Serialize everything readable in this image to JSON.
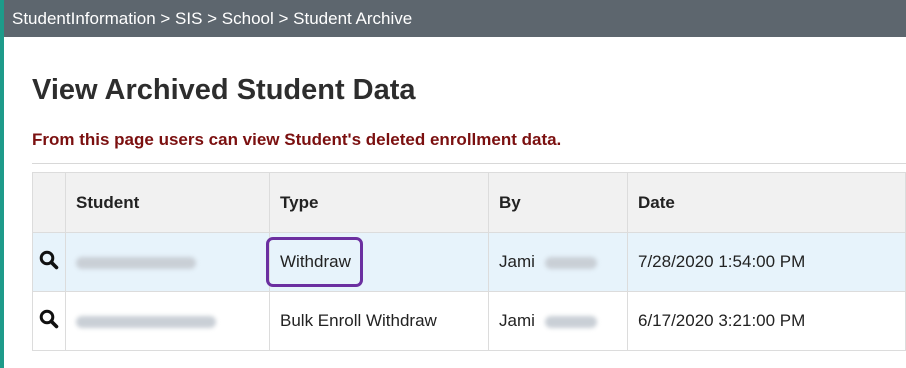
{
  "breadcrumb": "StudentInformation > SIS > School > Student Archive",
  "page": {
    "title": "View Archived Student Data",
    "subtitle": "From this page users can view Student's deleted enrollment data."
  },
  "table": {
    "headers": {
      "icon": "",
      "student": "Student",
      "type": "Type",
      "by": "By",
      "date": "Date"
    },
    "rows": [
      {
        "action_icon": "search-icon",
        "student": "",
        "type": "Withdraw",
        "by_first": "Jami",
        "date": "7/28/2020 1:54:00 PM",
        "highlighted": true
      },
      {
        "action_icon": "search-icon",
        "student": "",
        "type": "Bulk Enroll Withdraw",
        "by_first": "Jami",
        "date": "6/17/2020 3:21:00 PM",
        "highlighted": false
      }
    ]
  },
  "colors": {
    "breadcrumb_bg": "#5d666e",
    "accent_rule": "#1e9b8a",
    "subtitle_text": "#7b1010",
    "highlight_border": "#6b2fa0",
    "selected_row_bg": "#e7f3fb"
  }
}
